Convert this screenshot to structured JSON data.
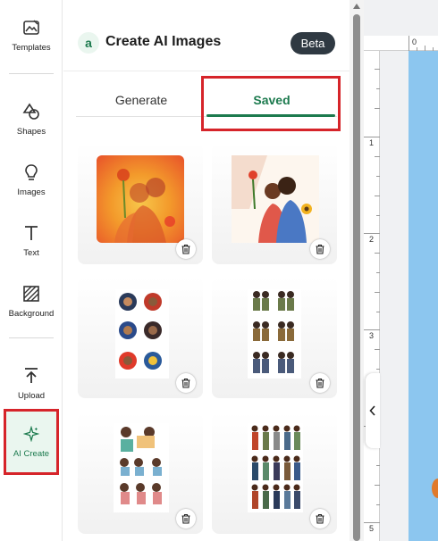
{
  "sidebar": {
    "items": [
      {
        "label": "Templates",
        "icon": "templates-icon"
      },
      {
        "label": "Shapes",
        "icon": "shapes-icon"
      },
      {
        "label": "Images",
        "icon": "lightbulb-icon"
      },
      {
        "label": "Text",
        "icon": "text-icon"
      },
      {
        "label": "Background",
        "icon": "background-icon"
      },
      {
        "label": "Upload",
        "icon": "upload-icon"
      },
      {
        "label": "AI Create",
        "icon": "sparkle-icon",
        "active": true
      }
    ]
  },
  "header": {
    "logo_glyph": "a",
    "title": "Create AI Images",
    "badge": "Beta"
  },
  "tabs": [
    {
      "label": "Generate",
      "active": false
    },
    {
      "label": "Saved",
      "active": true
    }
  ],
  "gallery": {
    "items": [
      {
        "subject": "couple with flowers orange painting",
        "delete_icon": "trash-icon"
      },
      {
        "subject": "couple hugging with sunflowers illustration",
        "delete_icon": "trash-icon"
      },
      {
        "subject": "cartoon character sticker sheet",
        "delete_icon": "trash-icon"
      },
      {
        "subject": "couple sticker sheet",
        "delete_icon": "trash-icon"
      },
      {
        "subject": "girls reading sticker sheet",
        "delete_icon": "trash-icon"
      },
      {
        "subject": "people standing sticker sheet",
        "delete_icon": "trash-icon"
      }
    ]
  },
  "canvas": {
    "ruler_top": [
      "0"
    ],
    "ruler_left": [
      "1",
      "2",
      "3",
      "4",
      "5"
    ],
    "collapse_icon": "chevron-left-icon"
  },
  "colors": {
    "accent_green": "#1c7a4e",
    "highlight_red": "#d6242a",
    "badge_bg": "#2f3942",
    "page_blue": "#8cc6ef"
  }
}
